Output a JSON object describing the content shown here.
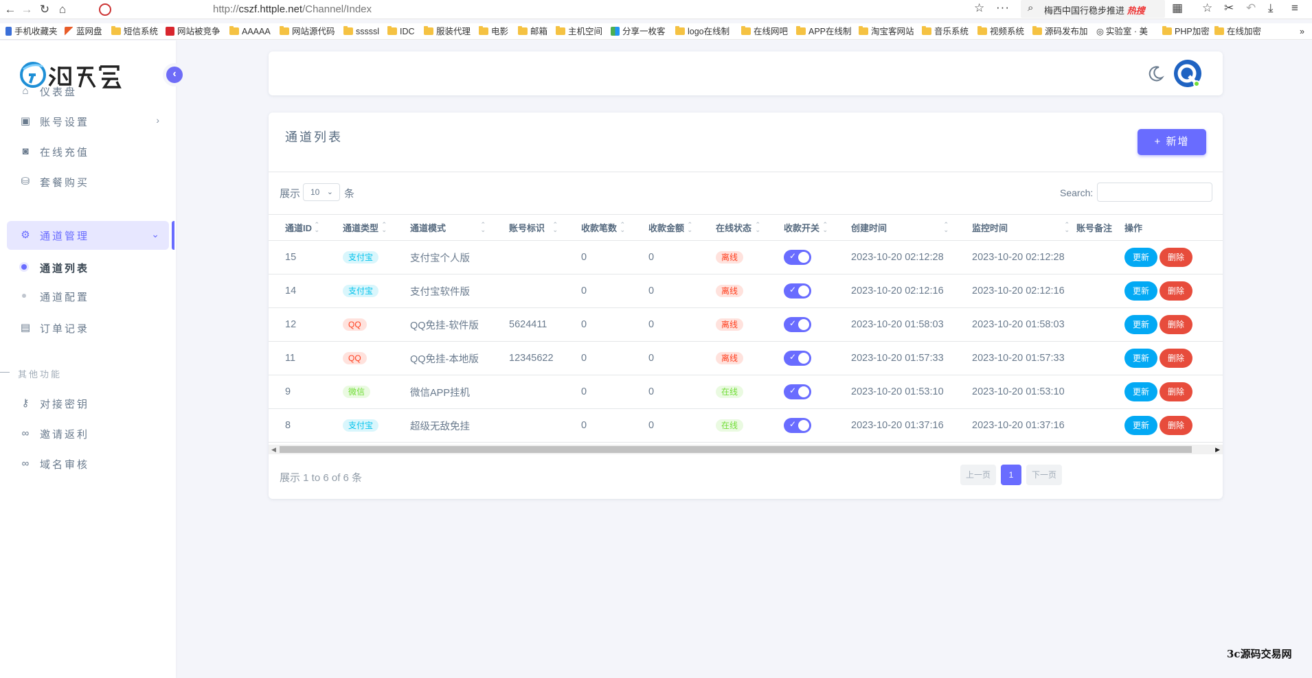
{
  "browser": {
    "url_prefix": "http://",
    "url_host": "cszf.httple.net",
    "url_path": "/Channel/Index",
    "search_text": "梅西中国行稳步推进",
    "search_badge": "热搜",
    "bookmarks": [
      "手机收藏夹",
      "蓝网盘",
      "短信系统",
      "网站被竞争",
      "AAAAA",
      "网站源代码",
      "sssssl",
      "IDC",
      "服装代理",
      "电影",
      "邮箱",
      "主机空间",
      "分享一枚客",
      "logo在线制",
      "在线网吧",
      "APP在线制",
      "淘宝客网站",
      "音乐系统",
      "视频系统",
      "源码发布加",
      "实验室 · 美",
      "PHP加密",
      "在线加密"
    ]
  },
  "sidebar": {
    "collapse_icon": "chevron-left-icon",
    "menu": [
      {
        "label": "仪表盘",
        "icon": "home-icon"
      },
      {
        "label": "账号设置",
        "icon": "user-card-icon"
      },
      {
        "label": "在线充值",
        "icon": "wallet-icon"
      },
      {
        "label": "套餐购买",
        "icon": "shopping-bag-icon"
      },
      {
        "label": "通道管理",
        "icon": "gear-icon"
      }
    ],
    "submenu": [
      {
        "label": "通道列表"
      },
      {
        "label": "通道配置"
      }
    ],
    "menu_after": [
      {
        "label": "订单记录",
        "icon": "wallet-icon"
      }
    ],
    "section_header": "其他功能",
    "menu_other": [
      {
        "label": "对接密钥",
        "icon": "key-icon"
      },
      {
        "label": "邀请返利",
        "icon": "link-icon"
      },
      {
        "label": "域名审核",
        "icon": "link-icon"
      }
    ]
  },
  "card": {
    "title": "通道列表",
    "add_button": "+ 新增",
    "show_prefix": "展示",
    "page_length": "10",
    "show_suffix": "条",
    "search_label": "Search:",
    "info": "展示 1 to 6 of 6 条",
    "pagination": {
      "prev": "上一页",
      "current": "1",
      "next": "下一页"
    }
  },
  "table": {
    "columns": [
      "通道ID",
      "通道类型",
      "通道模式",
      "账号标识",
      "收款笔数",
      "收款金额",
      "在线状态",
      "收款开关",
      "创建时间",
      "监控时间",
      "账号备注",
      "操作"
    ],
    "rows": [
      {
        "id": "15",
        "type": "支付宝",
        "type_color": "#03c3ec",
        "mode": "支付宝个人版",
        "account": "",
        "count": "0",
        "amount": "0",
        "status": "离线",
        "status_color": "#ff3e1d",
        "created": "2023-10-20 02:12:28",
        "monitor": "2023-10-20 02:12:28",
        "note": "",
        "update": "更新",
        "delete": "删除"
      },
      {
        "id": "14",
        "type": "支付宝",
        "type_color": "#03c3ec",
        "mode": "支付宝软件版",
        "account": "",
        "count": "0",
        "amount": "0",
        "status": "离线",
        "status_color": "#ff3e1d",
        "created": "2023-10-20 02:12:16",
        "monitor": "2023-10-20 02:12:16",
        "note": "",
        "update": "更新",
        "delete": "删除"
      },
      {
        "id": "12",
        "type": "QQ",
        "type_color": "#ff3e1d",
        "mode": "QQ免挂-软件版",
        "account": "5624411",
        "count": "0",
        "amount": "0",
        "status": "离线",
        "status_color": "#ff3e1d",
        "created": "2023-10-20 01:58:03",
        "monitor": "2023-10-20 01:58:03",
        "note": "",
        "update": "更新",
        "delete": "删除"
      },
      {
        "id": "11",
        "type": "QQ",
        "type_color": "#ff3e1d",
        "mode": "QQ免挂-本地版",
        "account": "12345622",
        "count": "0",
        "amount": "0",
        "status": "离线",
        "status_color": "#ff3e1d",
        "created": "2023-10-20 01:57:33",
        "monitor": "2023-10-20 01:57:33",
        "note": "",
        "update": "更新",
        "delete": "删除"
      },
      {
        "id": "9",
        "type": "微信",
        "type_color": "#71dd37",
        "mode": "微信APP挂机",
        "account": "",
        "count": "0",
        "amount": "0",
        "status": "在线",
        "status_color": "#71dd37",
        "created": "2023-10-20 01:53:10",
        "monitor": "2023-10-20 01:53:10",
        "note": "",
        "update": "更新",
        "delete": "删除"
      },
      {
        "id": "8",
        "type": "支付宝",
        "type_color": "#03c3ec",
        "mode": "超级无敌免挂",
        "account": "",
        "count": "0",
        "amount": "0",
        "status": "在线",
        "status_color": "#71dd37",
        "created": "2023-10-20 01:37:16",
        "monitor": "2023-10-20 01:37:16",
        "note": "",
        "update": "更新",
        "delete": "删除"
      }
    ]
  },
  "watermark": "3c源码交易网",
  "colors": {
    "primary": "#696cff",
    "info": "#03a9f4",
    "danger": "#e74c3c",
    "success": "#71dd37"
  }
}
